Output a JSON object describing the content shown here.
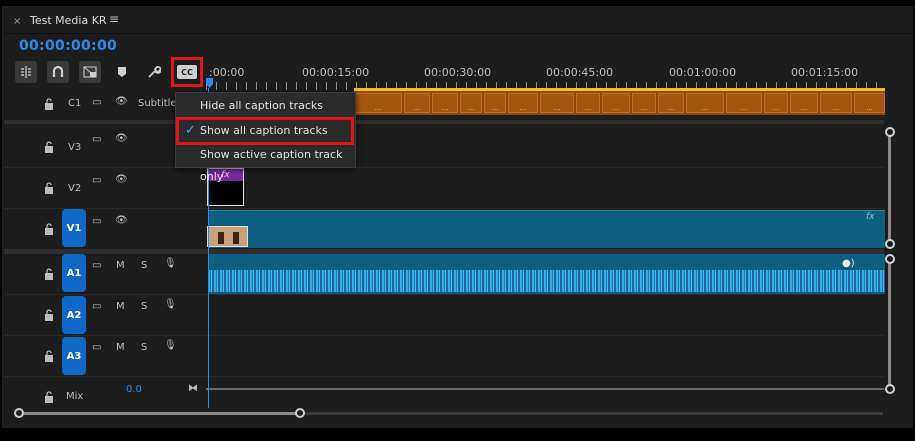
{
  "panel": {
    "close_symbol": "×",
    "title": "Test Media KR",
    "menu_symbol": "≡"
  },
  "timecode": "00:00:00:00",
  "toolbar": {
    "tools": [
      {
        "name": "insert-overwrite-icon",
        "glyph": "⇹"
      },
      {
        "name": "snap-magnet-icon",
        "glyph": "∩"
      },
      {
        "name": "linked-selection-icon",
        "glyph": "⬒"
      },
      {
        "name": "add-marker-icon",
        "glyph": "⬟"
      },
      {
        "name": "wrench-settings-icon",
        "glyph": "🔧"
      }
    ],
    "cc_label": "CC"
  },
  "ruler": {
    "labels": [
      ":00:00",
      "00:00:15:00",
      "00:00:30:00",
      "00:00:45:00",
      "00:01:00:00",
      "00:01:15:00"
    ]
  },
  "tracks": {
    "caption": {
      "name": "C1",
      "label": "Subtitle"
    },
    "v3": {
      "name": "V3"
    },
    "v2": {
      "name": "V2"
    },
    "v1": {
      "name": "V1"
    },
    "a1": {
      "name": "A1",
      "m": "M",
      "s": "S"
    },
    "a2": {
      "name": "A2",
      "m": "M",
      "s": "S"
    },
    "a3": {
      "name": "A3",
      "m": "M",
      "s": "S"
    },
    "mix": {
      "label": "Mix",
      "value": "0.0"
    }
  },
  "clips": {
    "v2_fx": "fx",
    "v1_fx": "fx",
    "caption_clip_marker": "..."
  },
  "menu": {
    "items": [
      {
        "label": "Hide all caption tracks",
        "checked": false
      },
      {
        "label": "Show all caption tracks",
        "checked": true
      },
      {
        "label": "Show active caption track only",
        "checked": false
      }
    ],
    "check_symbol": "✓"
  },
  "colors": {
    "accent": "#2d8ceb",
    "highlight": "#e0161e",
    "caption": "#a3560f",
    "video": "#0e5f7f",
    "track_badge": "#0f68c7"
  }
}
